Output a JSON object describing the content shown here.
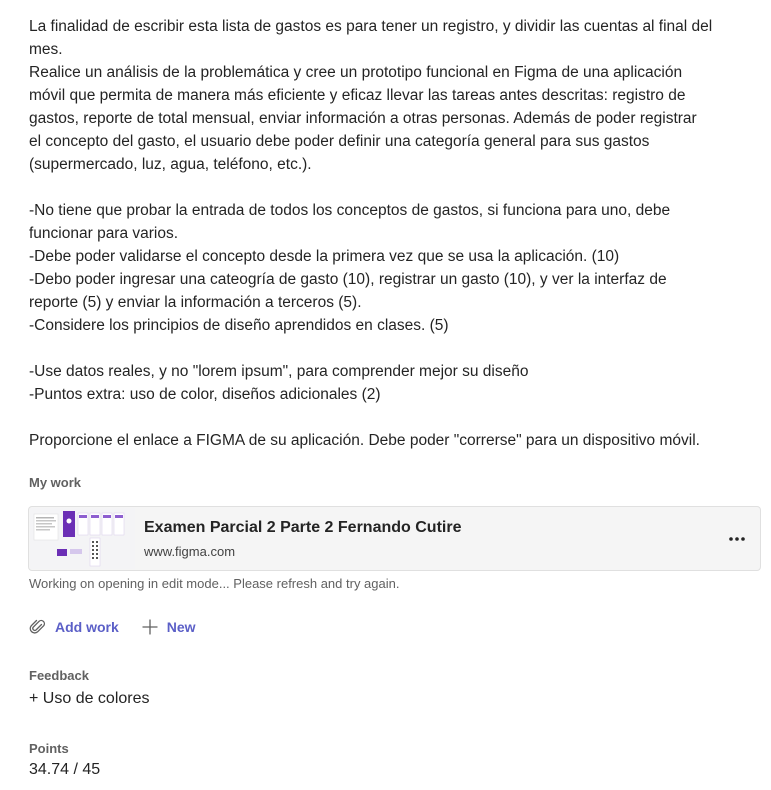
{
  "instructions": {
    "lines": [
      "La finalidad de escribir esta lista de gastos es para tener un registro, y dividir las cuentas al final del",
      "mes.",
      "Realice un análisis de la problemática y cree un prototipo funcional en Figma de una aplicación",
      "móvil que permita de manera más eficiente y eficaz llevar las tareas antes descritas: registro de",
      "gastos, reporte de total mensual, enviar información a otras personas. Además de poder registrar",
      "el concepto del gasto, el usuario debe poder definir una categoría general para sus gastos",
      "(supermercado, luz, agua, teléfono, etc.).",
      "",
      "-No tiene que probar la entrada de todos los conceptos de gastos, si funciona para uno, debe",
      "funcionar para varios.",
      "-Debe poder validarse el concepto desde la primera vez que se usa la aplicación. (10)",
      "-Debo poder ingresar una cateogría de gasto (10), registrar un gasto (10), y ver la interfaz de",
      "reporte (5) y enviar la información a terceros (5).",
      "-Considere los principios de diseño aprendidos en clases. (5)",
      "",
      "-Use datos reales, y no \"lorem ipsum\", para comprender mejor su diseño",
      "-Puntos extra: uso de color, diseños adicionales (2)",
      "",
      "Proporcione el enlace a FIGMA de su aplicación. Debe poder \"correrse\" para un dispositivo móvil."
    ]
  },
  "my_work": {
    "label": "My work",
    "card": {
      "title": "Examen Parcial 2 Parte 2 Fernando Cutire",
      "url": "www.figma.com",
      "more_icon": "more-horizontal-icon"
    },
    "status": "Working on opening in edit mode... Please refresh and try again."
  },
  "actions": {
    "add_work": "Add work",
    "add_work_icon": "paperclip-icon",
    "new": "New",
    "new_icon": "plus-icon"
  },
  "feedback": {
    "label": "Feedback",
    "text": "+ Uso de colores"
  },
  "points": {
    "label": "Points",
    "value": "34.74 / 45"
  },
  "colors": {
    "accent": "#5b5fc7",
    "text": "#242424",
    "muted": "#616161",
    "card_bg": "#f5f5f5",
    "thumb_purple": "#6b2fb5"
  }
}
